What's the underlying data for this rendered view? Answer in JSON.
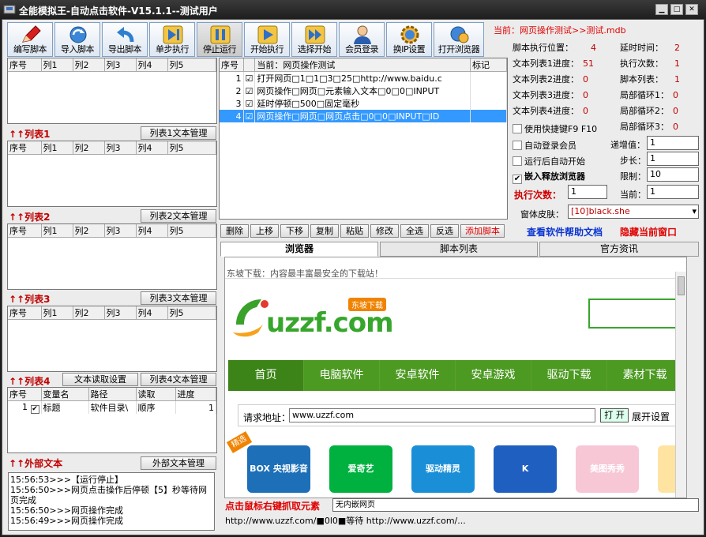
{
  "window": {
    "title": "全能模拟王-自动点击软件-V15.1.1--测试用户"
  },
  "toolbar": [
    {
      "label": "编写脚本",
      "icon": "pencil-icon"
    },
    {
      "label": "导入脚本",
      "icon": "refresh-icon"
    },
    {
      "label": "导出脚本",
      "icon": "undo-arrow-icon"
    },
    {
      "label": "单步执行",
      "icon": "step-forward-icon"
    },
    {
      "label": "停止运行",
      "icon": "pause-icon"
    },
    {
      "label": "开始执行",
      "icon": "play-icon"
    },
    {
      "label": "选择开始",
      "icon": "fast-forward-icon"
    },
    {
      "label": "会员登录",
      "icon": "user-icon"
    },
    {
      "label": "换IP设置",
      "icon": "gear-globe-icon"
    },
    {
      "label": "打开浏览器",
      "icon": "browser-icon"
    }
  ],
  "current_script": "当前：网页操作测试>>测试.mdb",
  "stats": {
    "exec_pos_label": "脚本执行位置：",
    "exec_pos": "4",
    "delay_label": "延时时间：",
    "delay": "2",
    "list1_label": "文本列表1进度：",
    "list1": "51",
    "exec_count_label": "执行次数：",
    "exec_count": "1",
    "list2_label": "文本列表2进度：",
    "list2": "0",
    "script_list_label": "脚本列表：",
    "script_list": "1",
    "list3_label": "文本列表3进度：",
    "list3": "0",
    "loop1_label": "局部循环1：",
    "loop1": "0",
    "list4_label": "文本列表4进度：",
    "list4": "0",
    "loop2_label": "局部循环2：",
    "loop2": "0",
    "loop3_label": "局部循环3：",
    "loop3": "0"
  },
  "options": {
    "hotkey": "使用快捷键F9 F10",
    "auto_login": "自动登录会员",
    "auto_start": "运行后自动开始",
    "embed_browser": "嵌入释放浏览器",
    "increment_label": "递增值：",
    "increment": "1",
    "step_label": "步长：",
    "step": "1",
    "limit_label": "限制：",
    "limit": "10",
    "exec_times_label": "执行次数：",
    "exec_times": "1",
    "current_label": "当前：",
    "current": "1",
    "skin_label": "窗体皮肤：",
    "skin": "[10]black.she"
  },
  "list_headers": [
    "序号",
    "列1",
    "列2",
    "列3",
    "列4",
    "列5"
  ],
  "lists": {
    "list1_title": "列表1",
    "list1_btn": "列表1文本管理",
    "list2_title": "列表2",
    "list2_btn": "列表2文本管理",
    "list3_title": "列表3",
    "list3_btn": "列表3文本管理",
    "list4_title": "列表4",
    "list4_read_btn": "文本读取设置",
    "list4_btn": "列表4文本管理"
  },
  "list4_table": {
    "headers": [
      "序号",
      "变量名",
      "路径",
      "读取",
      "进度"
    ],
    "rows": [
      {
        "no": "1",
        "name": "标题",
        "path": "软件目录\\",
        "read": "顺序",
        "progress": "1"
      }
    ]
  },
  "external": {
    "title": "外部文本",
    "btn": "外部文本管理"
  },
  "log": [
    "15:56:53>>>【运行停止】",
    "15:56:50>>>网页点击操作后停顿【5】秒等待网页完成",
    "15:56:50>>>网页操作完成",
    "15:56:49>>>网页操作完成"
  ],
  "script_table": {
    "headers": [
      "序号",
      "当前：网页操作测试",
      "标记"
    ],
    "rows": [
      {
        "no": "1",
        "text": "打开网页□1□1□3□25□http://www.baidu.c"
      },
      {
        "no": "2",
        "text": "网页操作□网页□元素输入文本□0□0□INPUT"
      },
      {
        "no": "3",
        "text": "延时停顿□500□固定毫秒"
      },
      {
        "no": "4",
        "text": "网页操作□网页□网页点击□0□0□INPUT□ID"
      }
    ]
  },
  "edit_buttons": [
    "删除",
    "上移",
    "下移",
    "复制",
    "粘贴",
    "修改",
    "全选",
    "反选",
    "添加脚本"
  ],
  "links": {
    "help": "查看软件帮助文档",
    "hide": "隐藏当前窗口"
  },
  "tabs": [
    "浏览器",
    "脚本列表",
    "官方资讯"
  ],
  "browser": {
    "slogan": "东坡下载：内容最丰富最安全的下载站！",
    "logo_text": "uzzf.com",
    "logo_badge": "东坡下载",
    "nav": [
      "首页",
      "电脑软件",
      "安卓软件",
      "安卓游戏",
      "驱动下载",
      "素材下载"
    ],
    "request_label": "请求地址：",
    "url": "www.uzzf.com",
    "open_btn": "打 开",
    "expand_btn": "展开设置",
    "featured_badge": "精选",
    "apps": [
      "BOX 央视影音",
      "爱奇艺",
      "驱动精灵",
      "K",
      "美图秀秀",
      ""
    ],
    "app_colors": [
      "#1d6fb8",
      "#00b140",
      "#1a8fd8",
      "#1f5fbf",
      "#f7c7d6",
      "#ffe3a0"
    ]
  },
  "right_click_hint": "点击鼠标右键抓取元素",
  "right_click_value": "无内嵌网页",
  "statusbar": "http://www.uzzf.com/■0l0■等待 http://www.uzzf.com/..."
}
